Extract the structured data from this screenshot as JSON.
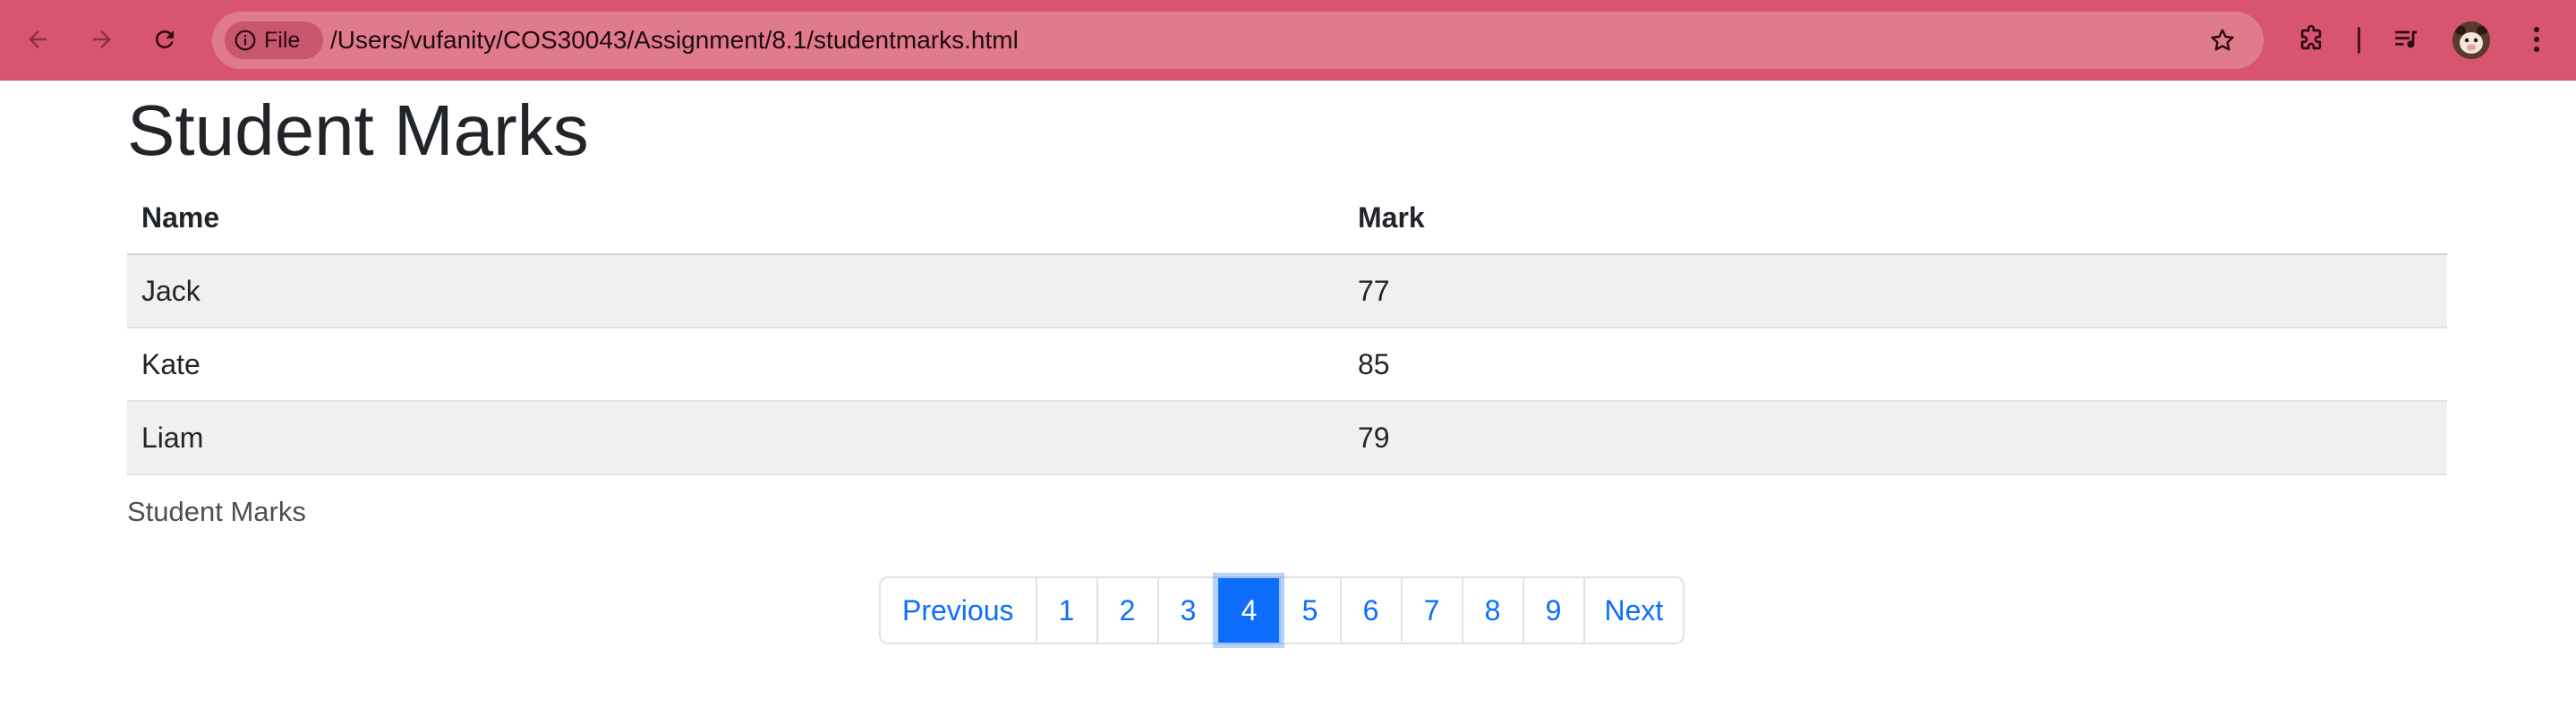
{
  "browser": {
    "file_chip_label": "File",
    "url": "/Users/vufanity/COS30043/Assignment/8.1/studentmarks.html",
    "accent_color": "#d9546f"
  },
  "page": {
    "title": "Student Marks",
    "table": {
      "headers": [
        "Name",
        "Mark"
      ],
      "rows": [
        {
          "name": "Jack",
          "mark": "77"
        },
        {
          "name": "Kate",
          "mark": "85"
        },
        {
          "name": "Liam",
          "mark": "79"
        }
      ]
    },
    "caption": "Student Marks"
  },
  "pagination": {
    "previous_label": "Previous",
    "next_label": "Next",
    "pages": [
      "1",
      "2",
      "3",
      "4",
      "5",
      "6",
      "7",
      "8",
      "9"
    ],
    "active_page": "4",
    "active_color": "#0d6efd"
  }
}
